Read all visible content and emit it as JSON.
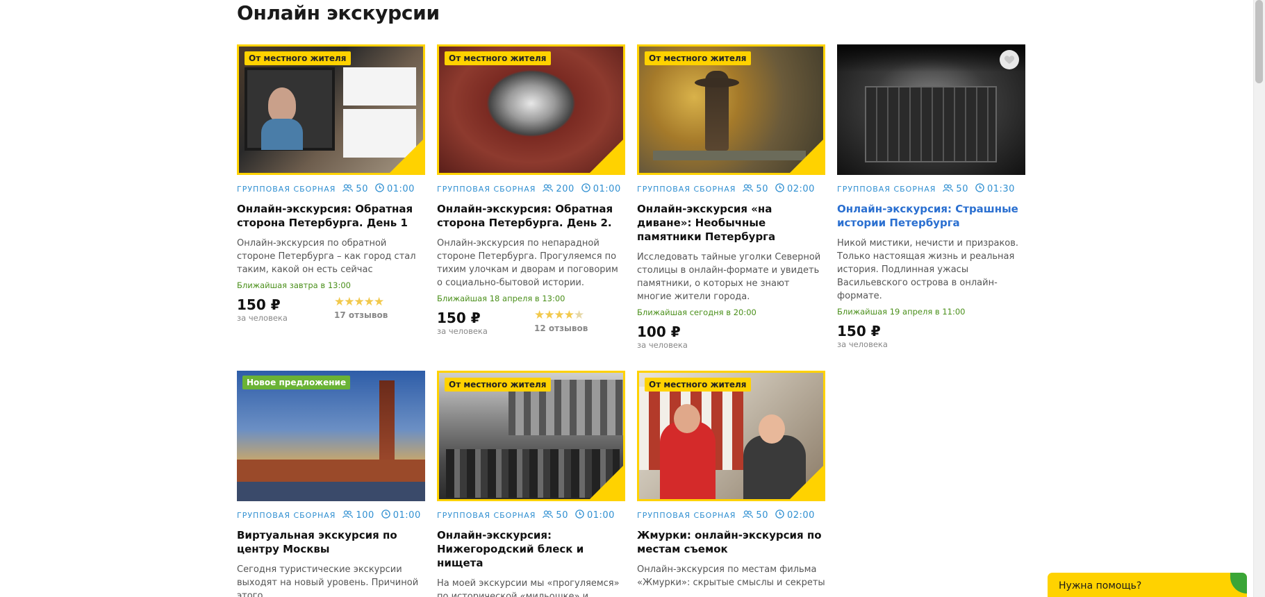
{
  "page": {
    "title": "Онлайн экскурсии"
  },
  "cards": [
    {
      "badge": "От местного жителя",
      "type": "Групповая сборная",
      "people": "50",
      "duration": "01:00",
      "title": "Онлайн-экскурсия: Обратная сторона Петербурга. День 1",
      "description": "Онлайн-экскурсия по обратной стороне Петербурга – как город стал таким, какой он есть сейчас",
      "nearest": "Ближайшая завтра в 13:00",
      "price": "150 ₽",
      "per_person": "за человека",
      "rating": 5,
      "reviews": "17 отзывов"
    },
    {
      "badge": "От местного жителя",
      "type": "Групповая сборная",
      "people": "200",
      "duration": "01:00",
      "title": "Онлайн-экскурсия: Обратная сторона Петербурга. День 2.",
      "description": "Онлайн-экскурсия по непарадной стороне Петербурга. Прогуляемся по тихим улочкам и дворам и поговорим о социально-бытовой истории.",
      "nearest": "Ближайшая 18 апреля в 13:00",
      "price": "150 ₽",
      "per_person": "за человека",
      "rating": 4.5,
      "reviews": "12 отзывов"
    },
    {
      "badge": "От местного жителя",
      "type": "Групповая сборная",
      "people": "50",
      "duration": "02:00",
      "title": "Онлайн-экскурсия «на диване»: Необычные памятники Петербурга",
      "description": "Исследовать тайные уголки Северной столицы в онлайн-формате и увидеть памятники, о которых не знают многие жители города.",
      "nearest": "Ближайшая сегодня в 20:00",
      "price": "100 ₽",
      "per_person": "за человека"
    },
    {
      "badge": "",
      "type": "Групповая сборная",
      "people": "50",
      "duration": "01:30",
      "title": "Онлайн-экскурсия: Страшные истории Петербурга",
      "description": "Никой мистики, нечисти и призраков. Только настоящая жизнь и реальная история. Подлинная ужасы Васильевского острова в онлайн-формате.",
      "nearest": "Ближайшая 19 апреля в 11:00",
      "price": "150 ₽",
      "per_person": "за человека"
    },
    {
      "badge": "Новое предложение",
      "type": "Групповая сборная",
      "people": "100",
      "duration": "01:00",
      "title": "Виртуальная экскурсия по центру Москвы",
      "description": "Сегодня туристические экскурсии выходят на новый уровень. Причиной этого"
    },
    {
      "badge": "От местного жителя",
      "type": "Групповая сборная",
      "people": "50",
      "duration": "01:00",
      "title": "Онлайн-экскурсия: Нижегородский блеск и нищета",
      "description": "На моей экскурсии мы «прогуляемся» по исторической «мильошке» и увидим"
    },
    {
      "badge": "От местного жителя",
      "type": "Групповая сборная",
      "people": "50",
      "duration": "02:00",
      "title": "Жмурки: онлайн-экскурсия по местам съемок",
      "description": "Онлайн-экскурсия по местам фильма «Жмурки»: скрытые смыслы и секреты"
    }
  ],
  "help": {
    "label": "Нужна помощь?"
  },
  "colors": {
    "accent": "#ffd200",
    "link": "#2f8fd1",
    "green": "#6ab335"
  },
  "icons": {
    "people": "people-icon",
    "clock": "clock-icon",
    "favorite": "heart-icon"
  }
}
